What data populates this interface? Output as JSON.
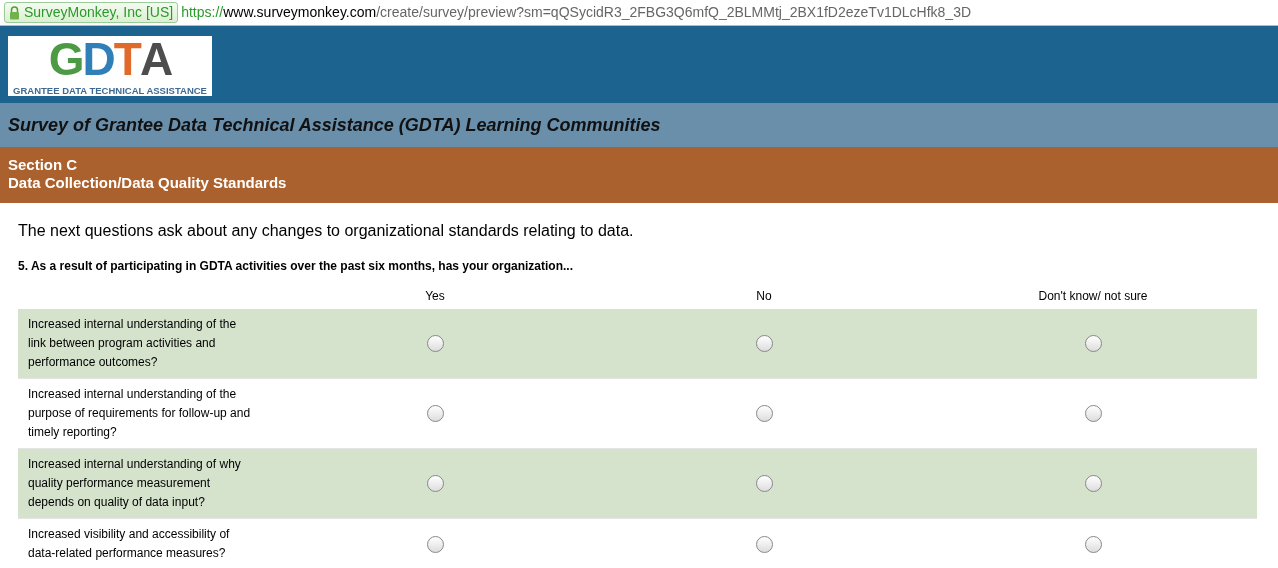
{
  "address_bar": {
    "identity": "SurveyMonkey, Inc [US]",
    "scheme": "https://",
    "host": "www.surveymonkey.com",
    "path": "/create/survey/preview?sm=qQSycidR3_2FBG3Q6mfQ_2BLMMtj_2BX1fD2ezeTv1DLcHfk8_3D"
  },
  "logo": {
    "letters": [
      {
        "text": "G",
        "color": "#4c9a44"
      },
      {
        "text": "D",
        "color": "#2f7fb8"
      },
      {
        "text": "T",
        "color": "#e06a2a"
      },
      {
        "text": "A",
        "color": "#4d4d4d"
      }
    ],
    "subtitle": "GRANTEE DATA TECHNICAL ASSISTANCE"
  },
  "survey_title": "Survey of Grantee Data Technical Assistance (GDTA) Learning Communities",
  "section": {
    "title": "Section C",
    "subtitle": "Data Collection/Data Quality Standards"
  },
  "intro": "The next questions ask about any changes to organizational standards relating to data.",
  "question": {
    "title": "5. As a result of participating in GDTA activities over the past six months, has your organization...",
    "columns": [
      "Yes",
      "No",
      "Don't know/ not sure"
    ],
    "rows": [
      {
        "label": "Increased internal understanding of the link between program activities and performance outcomes?",
        "options": [
          {
            "selected": false
          },
          {
            "selected": false
          },
          {
            "selected": false
          }
        ]
      },
      {
        "label": "Increased internal understanding of the purpose of requirements for follow-up and timely reporting?",
        "options": [
          {
            "selected": false
          },
          {
            "selected": false
          },
          {
            "selected": false
          }
        ]
      },
      {
        "label": "Increased internal understanding of why quality performance measurement depends on quality of data input?",
        "options": [
          {
            "selected": false
          },
          {
            "selected": false
          },
          {
            "selected": false
          }
        ]
      },
      {
        "label": "Increased visibility and accessibility of data-related performance measures?",
        "options": [
          {
            "selected": false
          },
          {
            "selected": false
          },
          {
            "selected": false
          }
        ]
      }
    ]
  }
}
